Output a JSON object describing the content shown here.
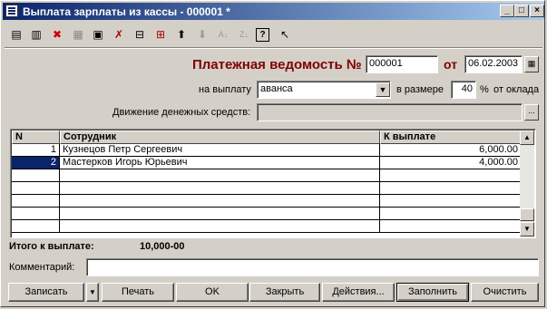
{
  "window": {
    "title": "Выплата зарплаты из кассы - 000001 *",
    "controls": {
      "minimize": "_",
      "maximize": "□",
      "close": "×"
    }
  },
  "toolbar": {
    "icons": [
      "new-row-icon",
      "copy-row-icon",
      "delete-row-icon",
      "edit-icon",
      "doc-icon",
      "delete-doc-icon",
      "select-icon",
      "subordinate-icon",
      "up-arrow-icon",
      "down-arrow-icon",
      "sort-asc-icon",
      "sort-desc-icon",
      "help-icon",
      "whats-this-icon"
    ]
  },
  "header": {
    "doc_title": "Платежная ведомость №",
    "number": "000001",
    "from_label": "от",
    "date": "06.02.2003",
    "payout_label": "на выплату",
    "payout_value": "аванса",
    "amount_label": "в размере",
    "percent_value": "40",
    "percent_sign": "%",
    "of_salary": "от оклада",
    "cash_flow_label": "Движение денежных средств:",
    "cash_flow_value": ""
  },
  "table": {
    "columns": [
      "N",
      "Сотрудник",
      "К выплате"
    ],
    "rows": [
      {
        "n": "1",
        "employee": "Кузнецов Петр Сергеевич",
        "amount": "6,000.00"
      },
      {
        "n": "2",
        "employee": "Мастерков Игорь Юрьевич",
        "amount": "4,000.00"
      }
    ],
    "selected_row": 2
  },
  "totals": {
    "label": "Итого к выплате:",
    "value": "10,000-00"
  },
  "comment": {
    "label": "Комментарий:",
    "value": ""
  },
  "buttons": {
    "save": "Записать",
    "print": "Печать",
    "ok": "OK",
    "close": "Закрыть",
    "actions": "Действия...",
    "fill": "Заполнить",
    "clear": "Очистить"
  },
  "colors": {
    "accent_title": "#800000",
    "selection": "#0a246a",
    "titlebar": "#0a246a"
  }
}
